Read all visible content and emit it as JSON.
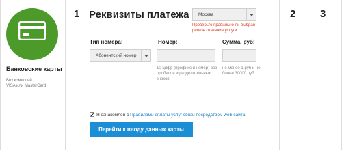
{
  "payment_method": {
    "title": "Банковские карты",
    "subtitle_1": "Без комиссий",
    "subtitle_2": "VISA или MasterCard",
    "icon": "credit-card-icon",
    "icon_bg": "#4c9a2a"
  },
  "steps": [
    "1",
    "2",
    "3"
  ],
  "form": {
    "heading": "Реквизиты платежа",
    "region_select": {
      "value": "Москва"
    },
    "region_warning": "Проверьте правильно ли выбран регион оказания услуги",
    "number_type": {
      "label": "Тип номера:",
      "value": "Абонентский номер"
    },
    "number": {
      "label": "Номер:",
      "hint": "10 цифр (префикс и номер) без пробелов и разделительных знаков."
    },
    "amount": {
      "label": "Сумма, руб:",
      "hint": "не менее 1 руб и не более 30000 руб."
    },
    "agree": {
      "checked": true,
      "text": "Я ознакомлен с ",
      "link_text": "Правилами оплаты услуг связи посредством web-сайта."
    },
    "submit_label": "Перейти к вводу данных карты"
  },
  "colors": {
    "accent": "#1b8ed6",
    "link": "#1b7fc4",
    "warning": "#d93a1f"
  }
}
